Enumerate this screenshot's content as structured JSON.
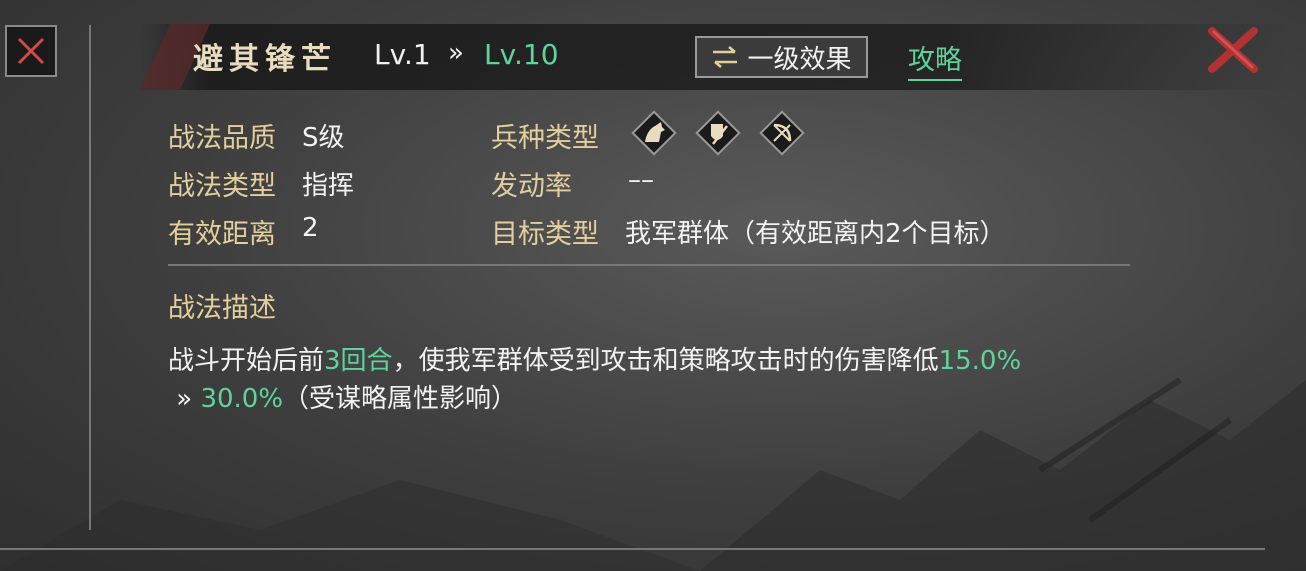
{
  "header": {
    "skill_name": "避其锋芒",
    "level_current": "Lv.1",
    "level_arrow": "»",
    "level_max": "Lv.10",
    "effect_button_label": "一级效果",
    "guide_link": "攻略"
  },
  "info": {
    "quality_label": "战法品质",
    "quality_value": "S级",
    "type_label": "战法类型",
    "type_value": "指挥",
    "range_label": "有效距离",
    "range_value": "2",
    "troop_label": "兵种类型",
    "troop_icons": [
      "cavalry-icon",
      "infantry-shield-icon",
      "archer-bow-icon"
    ],
    "trigger_label": "发动率",
    "trigger_value": "––",
    "target_label": "目标类型",
    "target_value": "我军群体（有效距离内2个目标）"
  },
  "description": {
    "title": "战法描述",
    "text_1": "战斗开始后前",
    "highlight_rounds": "3回合",
    "text_2": "，使我军群体受到攻击和策略攻击时的伤害降低",
    "highlight_min": "15.0%",
    "arrow": " » ",
    "highlight_max": "30.0%",
    "text_3": "（受谋略属性影响）"
  },
  "colors": {
    "accent_green": "#5ed49a",
    "label_gold": "#e3cf9c",
    "close_red": "#c03a3a"
  }
}
